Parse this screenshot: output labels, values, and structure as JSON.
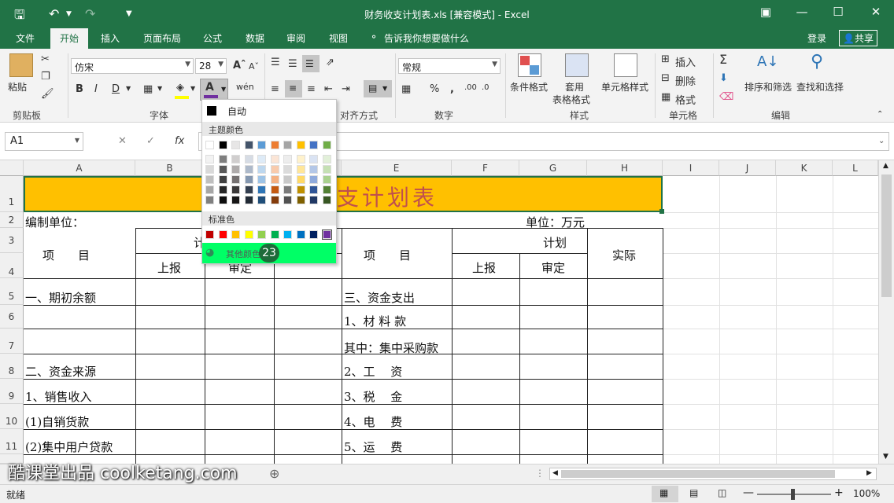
{
  "window": {
    "title": "财务收支计划表.xls  [兼容模式] - Excel",
    "qa_save_icon": "save-icon",
    "qa_undo_icon": "undo-icon",
    "qa_redo_icon": "redo-icon"
  },
  "menu": {
    "tabs": [
      "文件",
      "开始",
      "插入",
      "页面布局",
      "公式",
      "数据",
      "审阅",
      "视图"
    ],
    "active": "开始",
    "tell_me": "告诉我你想要做什么",
    "login": "登录",
    "share": "共享"
  },
  "ribbon": {
    "clipboard": {
      "paste": "粘贴",
      "label": "剪贴板"
    },
    "font": {
      "name": "仿宋",
      "size": "28",
      "label": "字体"
    },
    "alignment": {
      "label": "对齐方式"
    },
    "number": {
      "format": "常规",
      "label": "数字"
    },
    "styles": {
      "conditional": "条件格式",
      "table_line1": "套用",
      "table_line2": "表格格式",
      "cell_style": "单元格样式",
      "label": "样式"
    },
    "cells": {
      "insert": "插入",
      "delete": "删除",
      "format": "格式",
      "label": "单元格"
    },
    "editing": {
      "sort": "排序和筛选",
      "find": "查找和选择",
      "label": "编辑"
    }
  },
  "formula_bar": {
    "name_box": "A1",
    "fx": "fx"
  },
  "columns": [
    "A",
    "B",
    "C",
    "D",
    "E",
    "F",
    "G",
    "H",
    "I",
    "J",
    "K",
    "L"
  ],
  "rows": [
    "1",
    "2",
    "3",
    "4",
    "5",
    "6",
    "7",
    "8",
    "9",
    "10",
    "11"
  ],
  "sheet": {
    "title_visible": "支计划表",
    "r2_left": "编制单位：",
    "r2_right": "单位：万元",
    "hdr_item_left": "项　　目",
    "hdr_plan_left_partial": "计",
    "hdr_report_left": "上报",
    "hdr_approve_left_partial": "审定",
    "hdr_item_right": "项　　目",
    "hdr_plan_right": "计划",
    "hdr_report_right": "上报",
    "hdr_approve_right": "审定",
    "hdr_actual_right": "实际",
    "left_items": [
      "一、期初余额",
      "",
      "",
      "二、资金来源",
      "1、销售收入",
      "(1)自销货款",
      "(2)集中用户贷款"
    ],
    "right_items": [
      "三、资金支出",
      "1、材 料 款",
      "其中：集中采购款",
      "2、工　 资",
      "3、税　 金",
      "4、电　 费",
      "5、运　 费"
    ]
  },
  "palette": {
    "auto": "自动",
    "theme_label": "主题颜色",
    "standard_label": "标准色",
    "more_colors": "其他颜色...",
    "badge": "23",
    "theme_top": [
      "#ffffff",
      "#000000",
      "#e7e6e6",
      "#44546a",
      "#5b9bd5",
      "#ed7d31",
      "#a5a5a5",
      "#ffc000",
      "#4472c4",
      "#70ad47"
    ],
    "theme_tints": [
      [
        "#f2f2f2",
        "#7f7f7f",
        "#d0cece",
        "#d6dce5",
        "#deebf7",
        "#fbe5d6",
        "#ededed",
        "#fff2cc",
        "#dae3f3",
        "#e2f0d9"
      ],
      [
        "#d9d9d9",
        "#595959",
        "#aeabab",
        "#adb9ca",
        "#bdd7ee",
        "#f8cbad",
        "#dbdbdb",
        "#ffe699",
        "#b4c7e7",
        "#c5e0b4"
      ],
      [
        "#bfbfbf",
        "#404040",
        "#757171",
        "#8497b0",
        "#9dc3e6",
        "#f4b183",
        "#c9c9c9",
        "#ffd966",
        "#8faadc",
        "#a9d18e"
      ],
      [
        "#a6a6a6",
        "#262626",
        "#3a3838",
        "#333f50",
        "#2e75b6",
        "#c55a11",
        "#7b7b7b",
        "#bf9000",
        "#2f5597",
        "#538135"
      ],
      [
        "#808080",
        "#0d0d0d",
        "#171616",
        "#222a35",
        "#1f4e79",
        "#843c0c",
        "#525252",
        "#7f6000",
        "#203864",
        "#385723"
      ]
    ],
    "standard": [
      "#c00000",
      "#ff0000",
      "#ffc000",
      "#ffff00",
      "#92d050",
      "#00b050",
      "#00b0f0",
      "#0070c0",
      "#002060",
      "#7030a0"
    ]
  },
  "status": {
    "ready": "就绪",
    "zoom": "100%"
  },
  "watermark": "酷课堂出品 coolketang.com",
  "colors": {
    "excel_green": "#217346",
    "title_fill": "#ffc000",
    "title_text": "#c0504d",
    "highlight": "#00ff66",
    "badge": "#1e6b3a"
  }
}
